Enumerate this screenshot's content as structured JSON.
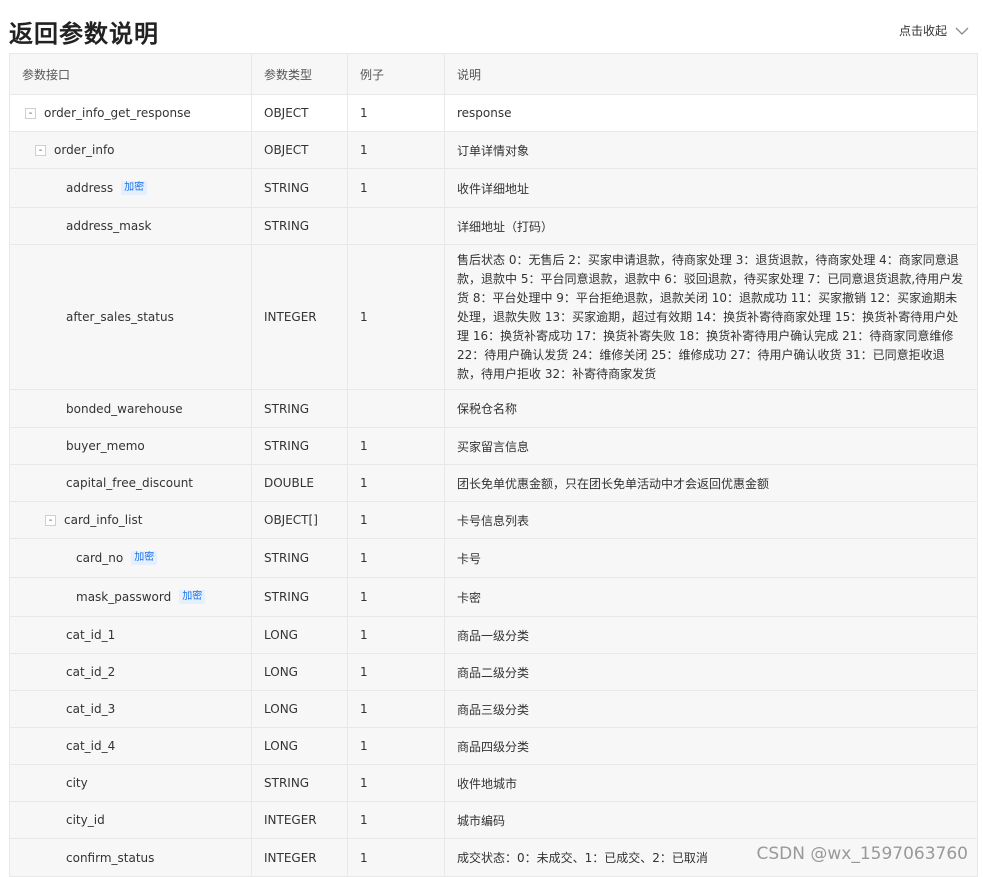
{
  "page": {
    "title": "返回参数说明",
    "collapse_label": "点击收起"
  },
  "table": {
    "columns": [
      "参数接口",
      "参数类型",
      "例子",
      "说明"
    ],
    "rows": [
      {
        "name": "order_info_get_response",
        "type": "OBJECT",
        "example": "1",
        "desc": "response",
        "expander": "-",
        "tag": ""
      },
      {
        "name": "order_info",
        "type": "OBJECT",
        "example": "1",
        "desc": "订单详情对象",
        "expander": "-",
        "tag": ""
      },
      {
        "name": "address",
        "type": "STRING",
        "example": "1",
        "desc": "收件详细地址",
        "expander": "",
        "tag": "加密"
      },
      {
        "name": "address_mask",
        "type": "STRING",
        "example": "",
        "desc": "详细地址（打码）",
        "expander": "",
        "tag": ""
      },
      {
        "name": "after_sales_status",
        "type": "INTEGER",
        "example": "1",
        "desc": "售后状态 0：无售后 2：买家申请退款，待商家处理 3：退货退款，待商家处理 4：商家同意退款，退款中 5：平台同意退款，退款中 6：驳回退款，待买家处理 7：已同意退货退款,待用户发货 8：平台处理中 9：平台拒绝退款，退款关闭 10：退款成功 11：买家撤销 12：买家逾期未处理，退款失败 13：买家逾期，超过有效期 14：换货补寄待商家处理 15：换货补寄待用户处理 16：换货补寄成功 17：换货补寄失败 18：换货补寄待用户确认完成 21：待商家同意维修 22：待用户确认发货 24：维修关闭 25：维修成功 27：待用户确认收货 31：已同意拒收退款，待用户拒收 32：补寄待商家发货",
        "expander": "",
        "tag": ""
      },
      {
        "name": "bonded_warehouse",
        "type": "STRING",
        "example": "",
        "desc": "保税仓名称",
        "expander": "",
        "tag": ""
      },
      {
        "name": "buyer_memo",
        "type": "STRING",
        "example": "1",
        "desc": "买家留言信息",
        "expander": "",
        "tag": ""
      },
      {
        "name": "capital_free_discount",
        "type": "DOUBLE",
        "example": "1",
        "desc": "团长免单优惠金额，只在团长免单活动中才会返回优惠金额",
        "expander": "",
        "tag": ""
      },
      {
        "name": "card_info_list",
        "type": "OBJECT[]",
        "example": "1",
        "desc": "卡号信息列表",
        "expander": "-",
        "tag": ""
      },
      {
        "name": "card_no",
        "type": "STRING",
        "example": "1",
        "desc": "卡号",
        "expander": "",
        "tag": "加密"
      },
      {
        "name": "mask_password",
        "type": "STRING",
        "example": "1",
        "desc": "卡密",
        "expander": "",
        "tag": "加密"
      },
      {
        "name": "cat_id_1",
        "type": "LONG",
        "example": "1",
        "desc": "商品一级分类",
        "expander": "",
        "tag": ""
      },
      {
        "name": "cat_id_2",
        "type": "LONG",
        "example": "1",
        "desc": "商品二级分类",
        "expander": "",
        "tag": ""
      },
      {
        "name": "cat_id_3",
        "type": "LONG",
        "example": "1",
        "desc": "商品三级分类",
        "expander": "",
        "tag": ""
      },
      {
        "name": "cat_id_4",
        "type": "LONG",
        "example": "1",
        "desc": "商品四级分类",
        "expander": "",
        "tag": ""
      },
      {
        "name": "city",
        "type": "STRING",
        "example": "1",
        "desc": "收件地城市",
        "expander": "",
        "tag": ""
      },
      {
        "name": "city_id",
        "type": "INTEGER",
        "example": "1",
        "desc": "城市编码",
        "expander": "",
        "tag": ""
      },
      {
        "name": "confirm_status",
        "type": "INTEGER",
        "example": "1",
        "desc": "成交状态：0：未成交、1：已成交、2：已取消",
        "expander": "",
        "tag": ""
      }
    ]
  },
  "watermark": "CSDN @wx_1597063760"
}
